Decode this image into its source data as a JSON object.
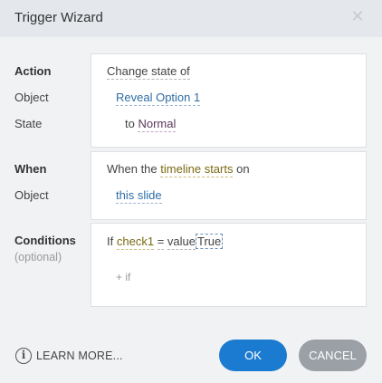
{
  "dialog": {
    "title": "Trigger Wizard",
    "close_glyph": "✕"
  },
  "action_section": {
    "label": "Action",
    "object_label": "Object",
    "state_label": "State",
    "action_value": "Change state of",
    "object_value": "Reveal Option 1",
    "to_text": "to",
    "state_value": "Normal"
  },
  "when_section": {
    "label": "When",
    "object_label": "Object",
    "when_prefix": "When the",
    "event_value": "timeline starts",
    "when_suffix": "on",
    "object_value": "this slide"
  },
  "conditions_section": {
    "label": "Conditions",
    "sublabel": "(optional)",
    "if_text": "If",
    "variable": "check1",
    "operator": "=",
    "value_type": "value",
    "value": "True",
    "add_condition": "+ if"
  },
  "footer": {
    "info_glyph": "i",
    "learn_more": "LEARN MORE...",
    "ok_label": "OK",
    "cancel_label": "CANCEL"
  },
  "colors": {
    "primary": "#1b7bd0",
    "secondary": "#9aa0a6",
    "link": "#2e6da4",
    "variable": "#7a6a12"
  }
}
